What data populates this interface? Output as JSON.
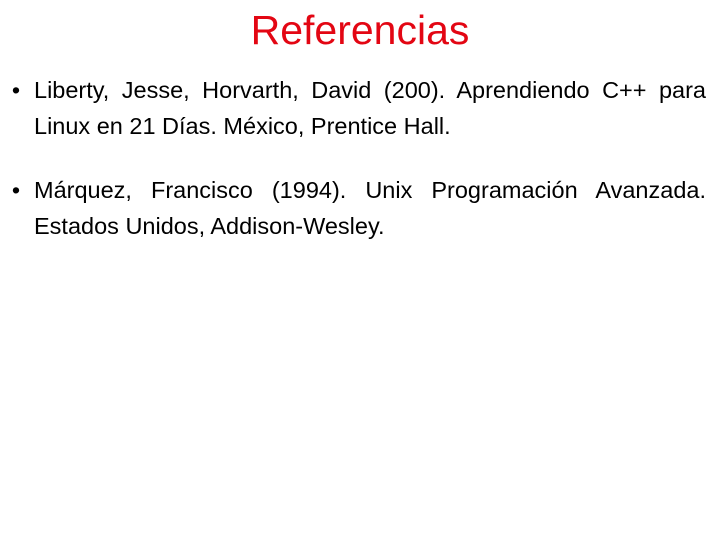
{
  "slide": {
    "title": "Referencias",
    "title_color": "#e30613",
    "bullet_glyph": "•",
    "references": [
      {
        "text": "Liberty, Jesse, Horvarth, David (200). Aprendiendo C++ para Linux en 21 Días. México, Prentice Hall."
      },
      {
        "text": "Márquez, Francisco (1994). Unix Programación Avanzada. Estados Unidos, Addison-Wesley."
      }
    ]
  }
}
